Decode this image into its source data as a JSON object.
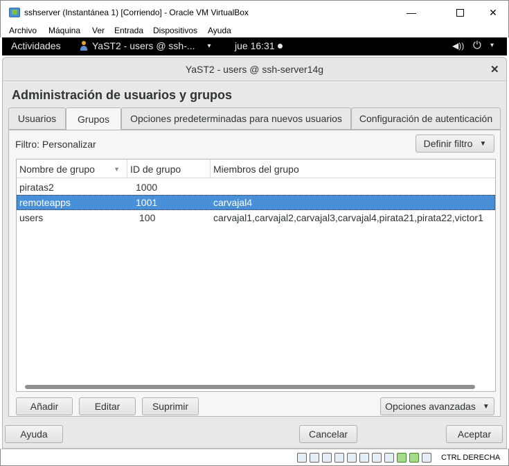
{
  "host_window": {
    "title": "sshserver (Instantánea 1) [Corriendo] - Oracle VM VirtualBox",
    "controls": {
      "minimize": "—",
      "close": "✕"
    },
    "menu": [
      "Archivo",
      "Máquina",
      "Ver",
      "Entrada",
      "Dispositivos",
      "Ayuda"
    ]
  },
  "gnome_bar": {
    "activities": "Actividades",
    "app_menu": "YaST2 - users @ ssh-...",
    "caret": "▾",
    "clock": "jue 16:31",
    "volume_icon": "◀))",
    "power_icon": "⏻",
    "power_caret": "▾"
  },
  "dialog": {
    "title": "YaST2 - users @ ssh-server14g",
    "close": "✕",
    "heading": "Administración de usuarios y grupos",
    "tabs": [
      {
        "label": "Usuarios",
        "active": false
      },
      {
        "label": "Grupos",
        "active": true
      },
      {
        "label": "Opciones predeterminadas para nuevos usuarios",
        "active": false
      },
      {
        "label": "Configuración de autenticación",
        "active": false
      }
    ],
    "filter_label": "Filtro: Personalizar",
    "filter_button": "Definir filtro",
    "dropdown_arrow": "▼",
    "table": {
      "columns": [
        "Nombre de grupo",
        "ID de grupo",
        "Miembros del grupo"
      ],
      "sort_indicator": "▼",
      "rows": [
        {
          "name": "piratas2",
          "id": "1000",
          "members": ""
        },
        {
          "name": "remoteapps",
          "id": "1001",
          "members": "carvajal4",
          "selected": true
        },
        {
          "name": "users",
          "id": "100",
          "members": "carvajal1,carvajal2,carvajal3,carvajal4,pirata21,pirata22,victor1"
        }
      ]
    },
    "actions": {
      "add": "Añadir",
      "edit": "Editar",
      "delete": "Suprimir",
      "advanced": "Opciones avanzadas"
    },
    "footer": {
      "help": "Ayuda",
      "cancel": "Cancelar",
      "accept": "Aceptar"
    }
  },
  "status_bar": {
    "host_key": "CTRL DERECHA"
  },
  "colors": {
    "selection": "#4a90d9",
    "gnome_bar": "#000000",
    "dialog_bg": "#e8e8e7"
  }
}
